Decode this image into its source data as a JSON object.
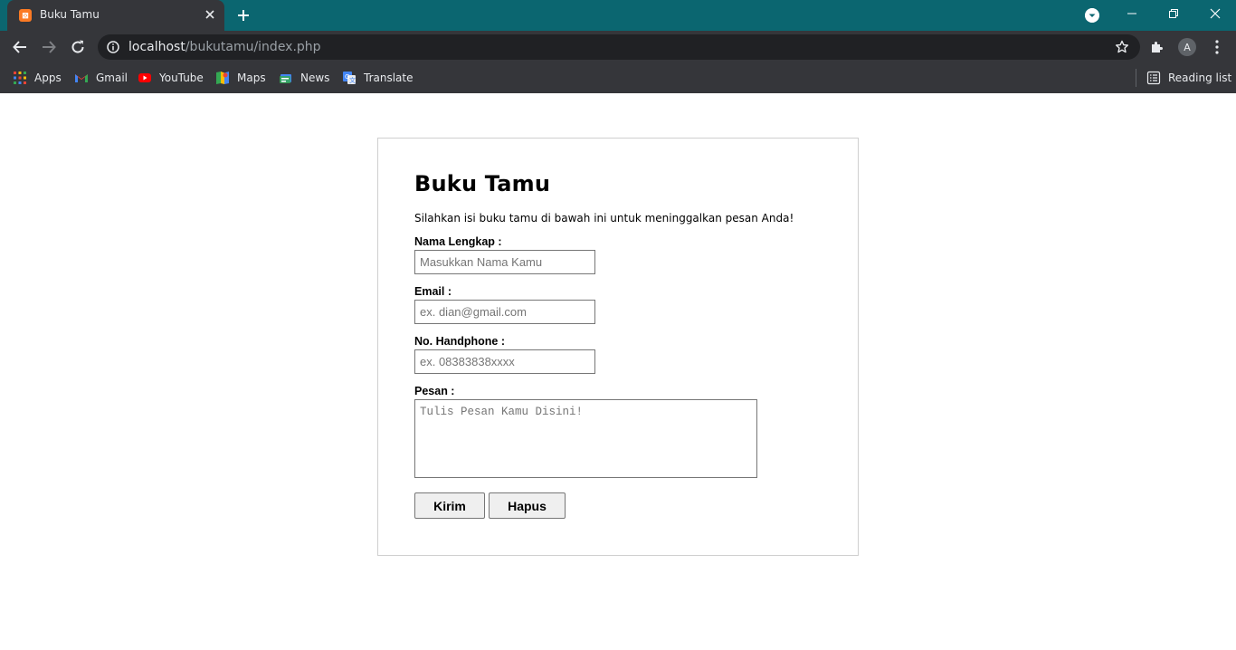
{
  "browser": {
    "tab_title": "Buku Tamu",
    "url_host": "localhost",
    "url_path": "/bukutamu/index.php",
    "avatar_letter": "A",
    "favicon_glyph": "☒"
  },
  "bookmarks": [
    {
      "label": "Apps",
      "icon": "apps-grid-icon"
    },
    {
      "label": "Gmail",
      "icon": "gmail-icon"
    },
    {
      "label": "YouTube",
      "icon": "youtube-icon"
    },
    {
      "label": "Maps",
      "icon": "maps-icon"
    },
    {
      "label": "News",
      "icon": "news-icon"
    },
    {
      "label": "Translate",
      "icon": "translate-icon"
    }
  ],
  "reading_list": "Reading list",
  "form": {
    "title": "Buku Tamu",
    "intro": "Silahkan isi buku tamu di bawah ini untuk meninggalkan pesan Anda!",
    "name_label": "Nama Lengkap :",
    "name_placeholder": "Masukkan Nama Kamu",
    "email_label": "Email :",
    "email_placeholder": "ex. dian@gmail.com",
    "phone_label": "No. Handphone :",
    "phone_placeholder": "ex. 08383838xxxx",
    "message_label": "Pesan :",
    "message_placeholder": "Tulis Pesan Kamu Disini!",
    "submit_label": "Kirim",
    "reset_label": "Hapus"
  },
  "colors": {
    "titlebar": "#0b6670",
    "chrome": "#35363a",
    "omnibox": "#202124",
    "favicon": "#fb7a24"
  }
}
